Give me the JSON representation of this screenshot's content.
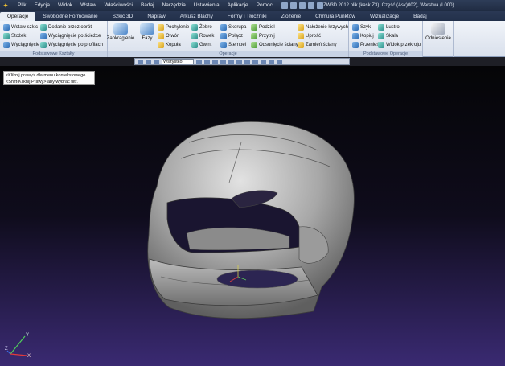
{
  "menu": [
    "Plik",
    "Edycja",
    "Widok",
    "Wstaw",
    "Właściwości",
    "Badaj",
    "Narzędzia",
    "Ustawienia",
    "Aplikacje",
    "Pomoc"
  ],
  "title": "ZW3D 2012          plik (kask.Z3), Część (Ask)002), Warstwa (L000)",
  "tabs": [
    "Operacje",
    "Swobodne Formowanie",
    "Szkic 3D",
    "Napraw",
    "Arkusz Blachy",
    "Formy i Tłoczniki",
    "Złożenie",
    "Chmura Punktów",
    "Wizualizacje",
    "Badaj"
  ],
  "ribbon": {
    "g1": {
      "label": "Podstawowe Kształty",
      "items": [
        "Wstaw szkic",
        "Stożek",
        "Wyciągnięcie",
        "Dodanie przez obrót",
        "Wyciągnięcie po ścieżce",
        "Wyciągnięcie po profilach"
      ]
    },
    "g2": {
      "label": "Operacje",
      "items": [
        "Zaokrąglenie",
        "Fazy",
        "Pochylenie",
        "Otwór",
        "Kopuła",
        "Żebro",
        "Rowek",
        "Gwint",
        "Skorupa",
        "Połącz",
        "Stempel",
        "Podziel",
        "Przytnij",
        "Odsunięcie ściany",
        "Nałożenie krzywych",
        "Uprość",
        "Zamień ściany"
      ]
    },
    "g3": {
      "label": "Podstawowe Operacje",
      "items": [
        "Szyk",
        "Kopiuj",
        "Przenieś",
        "Lustro",
        "Skala",
        "Widok przekroju"
      ]
    },
    "g4": {
      "label": "Odniesienie"
    }
  },
  "filter_value": "Wszystko",
  "hint": [
    "<Kliknij prawy> dla menu kontekstowego.",
    "<Shift-Kliknij Prawy> aby wybrać filtr."
  ],
  "axes": {
    "x": "X",
    "y": "Y",
    "z": "Z"
  },
  "colors": {
    "viewport_top": "#050507",
    "viewport_bottom": "#3a2a72",
    "ribbon": "#e3e9f3",
    "titlebar": "#243452"
  }
}
